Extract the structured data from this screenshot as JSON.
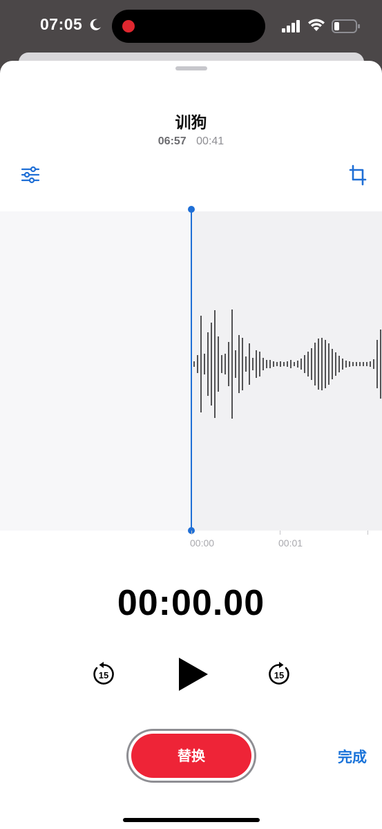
{
  "status_bar": {
    "time": "07:05",
    "icons": [
      "moon-icon",
      "recording-indicator",
      "signal-icon",
      "wifi-icon",
      "battery-icon"
    ]
  },
  "recording": {
    "title": "训狗",
    "time_of_day": "06:57",
    "duration": "00:41"
  },
  "toolbar": {
    "left_icon": "settings-sliders-icon",
    "right_icon": "trim-icon"
  },
  "timeline": {
    "ticks": [
      "00:00",
      "00:01"
    ]
  },
  "player": {
    "elapsed": "00:00.00",
    "skip_back_label": "15",
    "skip_forward_label": "15"
  },
  "actions": {
    "replace_label": "替换",
    "done_label": "完成"
  },
  "colors": {
    "accent_blue": "#1f6fd6",
    "replace_red": "#ee2437",
    "recording_red": "#e0272f"
  }
}
